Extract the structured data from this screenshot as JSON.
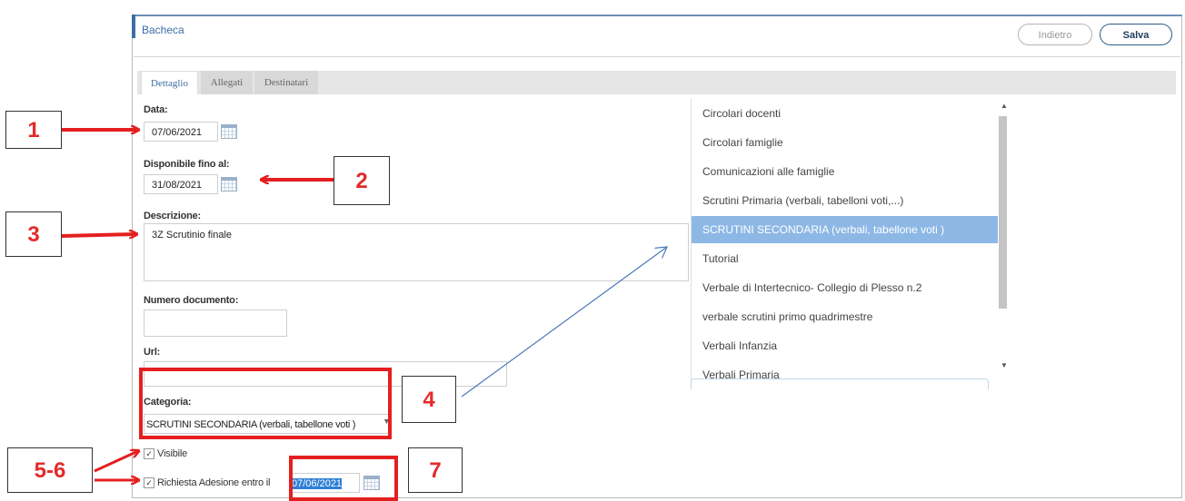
{
  "header": {
    "title": "Bacheca",
    "back_label": "Indietro",
    "save_label": "Salva"
  },
  "tabs": [
    {
      "label": "Dettaglio",
      "active": true
    },
    {
      "label": "Allegati",
      "active": false
    },
    {
      "label": "Destinatari",
      "active": false
    }
  ],
  "form": {
    "data_label": "Data:",
    "data_value": "07/06/2021",
    "disponibile_label": "Disponibile fino al:",
    "disponibile_value": "31/08/2021",
    "descrizione_label": "Descrizione:",
    "descrizione_value": "3Z Scrutinio finale",
    "numero_label": "Numero documento:",
    "numero_value": "",
    "url_label": "Url:",
    "url_value": "",
    "categoria_label": "Categoria:",
    "categoria_value": "SCRUTINI SECONDARIA (verbali, tabellone voti )",
    "visibile_label": "Visibile",
    "adesione_label": "Richiesta Adesione entro il",
    "adesione_value": "07/06/2021"
  },
  "dropdown": {
    "items": [
      "Circolari docenti",
      "Circolari famiglie",
      "Comunicazioni alle famiglie",
      "Scrutini Primaria (verbali, tabelloni voti,...)",
      "SCRUTINI SECONDARIA (verbali, tabellone voti )",
      "Tutorial",
      "Verbale di Intertecnico- Collegio di Plesso n.2",
      "verbale scrutini primo quadrimestre",
      "Verbali Infanzia",
      "Verbali Primaria"
    ],
    "selected_index": 4
  },
  "annotations": [
    "1",
    "2",
    "3",
    "4",
    "5-6",
    "7"
  ],
  "colors": {
    "accent": "#3a6ea5",
    "annotation_red": "#e51f1f",
    "selected_bg": "#8db8e6",
    "arrow_blue": "#4a7ab8"
  },
  "icons": {
    "calendar": "calendar-icon",
    "checkbox": "checkbox-checked-icon",
    "arrow": "arrow-icon"
  }
}
